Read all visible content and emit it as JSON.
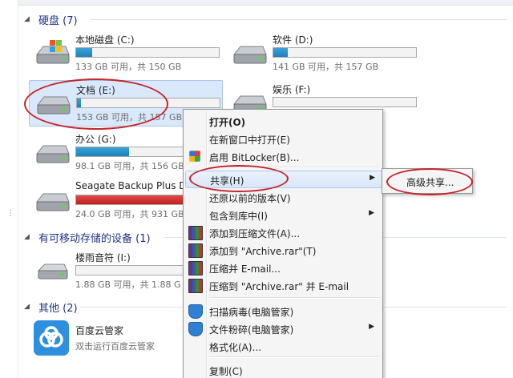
{
  "groups": {
    "hard_disks": {
      "title": "硬盘 (7)"
    },
    "removable": {
      "title": "有可移动存储的设备 (1)"
    },
    "other": {
      "title": "其他 (2)"
    }
  },
  "drives": [
    {
      "name": "本地磁盘 (C:)",
      "free": "133 GB 可用，共 150 GB",
      "used_fraction": 0.11,
      "bar": "normal"
    },
    {
      "name": "软件 (D:)",
      "free": "141 GB 可用，共 157 GB",
      "used_fraction": 0.1,
      "bar": "normal"
    },
    {
      "name": "文档 (E:)",
      "free": "153 GB 可用，共 157 GB",
      "used_fraction": 0.03,
      "bar": "normal"
    },
    {
      "name": "娱乐 (F:)",
      "free": "",
      "used_fraction": 0.0,
      "bar": "normal"
    },
    {
      "name": "办公 (G:)",
      "free": "98.1 GB 可用，共 156 GB",
      "used_fraction": 0.37,
      "bar": "normal"
    },
    {
      "name": "Seagate Backup Plus Dr",
      "free": "24.0 GB 可用，共 931 GB",
      "used_fraction": 0.97,
      "bar": "red"
    },
    {
      "name": "楼雨音符 (I:)",
      "free": "1.88 GB 可用，共 1.88 G",
      "used_fraction": 0.0,
      "bar": "normal"
    }
  ],
  "app": {
    "name": "百度云管家",
    "desc": "双击运行百度云管家"
  },
  "context_menu": {
    "items": [
      {
        "label": "打开(O)",
        "bold": true,
        "icon": "",
        "submenu": false
      },
      {
        "label": "在新窗口中打开(E)",
        "icon": "",
        "submenu": false
      },
      {
        "label": "启用 BitLocker(B)...",
        "icon": "bitlocker-icon",
        "submenu": false
      },
      {
        "label": "共享(H)",
        "icon": "",
        "submenu": true,
        "highlighted": true
      },
      {
        "label": "还原以前的版本(V)",
        "icon": "",
        "submenu": false
      },
      {
        "label": "包含到库中(I)",
        "icon": "",
        "submenu": true
      },
      {
        "label": "添加到压缩文件(A)...",
        "icon": "winrar-icon",
        "submenu": false
      },
      {
        "label": "添加到 \"Archive.rar\"(T)",
        "icon": "winrar-icon",
        "submenu": false
      },
      {
        "label": "压缩并 E-mail...",
        "icon": "winrar-icon",
        "submenu": false
      },
      {
        "label": "压缩到 \"Archive.rar\" 并 E-mail",
        "icon": "winrar-icon",
        "submenu": false
      },
      {
        "label": "扫描病毒(电脑管家)",
        "icon": "shield-icon",
        "submenu": false
      },
      {
        "label": "文件粉碎(电脑管家)",
        "icon": "shield-icon",
        "submenu": true
      },
      {
        "label": "格式化(A)...",
        "icon": "",
        "submenu": false
      },
      {
        "label": "复制(C)",
        "icon": "",
        "submenu": false
      }
    ]
  },
  "submenu": {
    "label": "高级共享..."
  },
  "colors": {
    "annotation": "#c7242a",
    "bar_blue": "#1c81bd",
    "bar_red": "#c21f1f",
    "group_title": "#1e3287"
  }
}
